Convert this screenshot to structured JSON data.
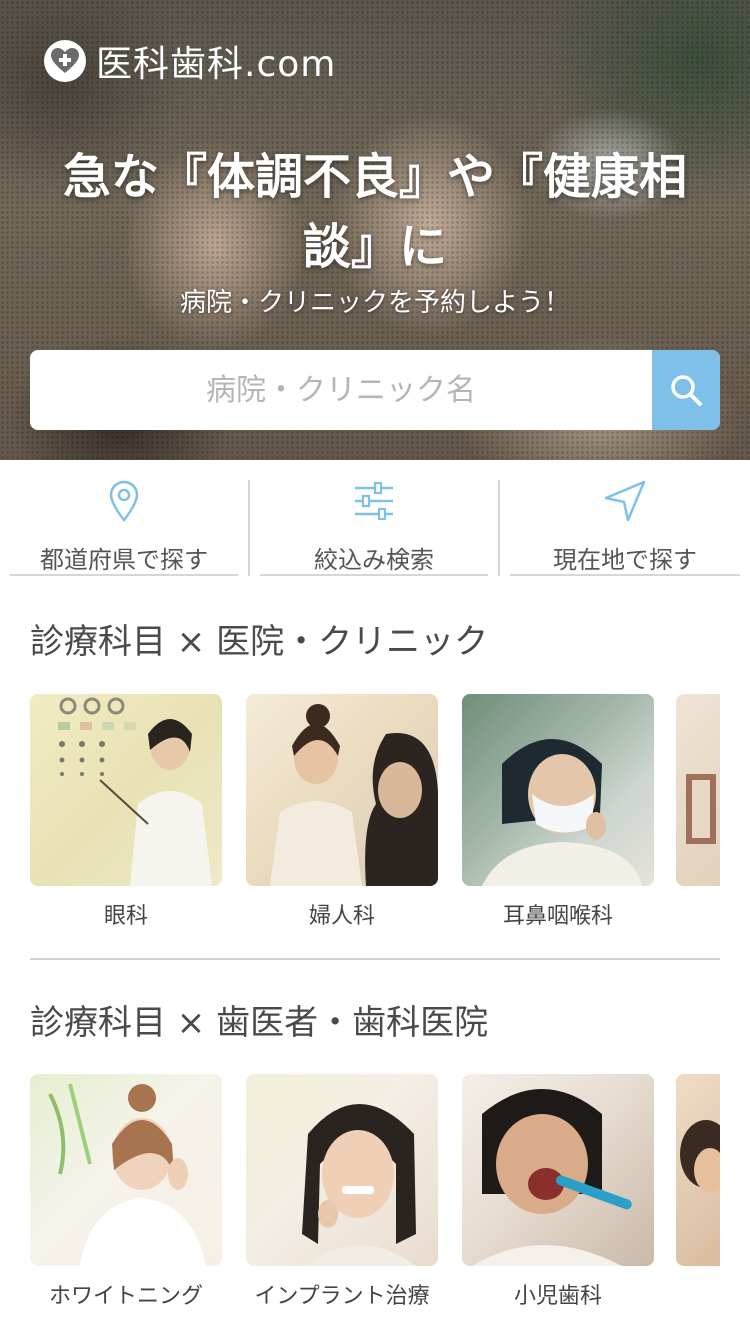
{
  "header": {
    "logo_text": "医科歯科.com",
    "headline": "急な『体調不良』や『健康相談』に",
    "subheadline": "病院・クリニックを予約しよう！"
  },
  "search": {
    "placeholder": "病院・クリニック名",
    "icon": "search-icon"
  },
  "quick_actions": [
    {
      "label": "都道府県で探す",
      "icon": "map-pin-icon"
    },
    {
      "label": "絞込み検索",
      "icon": "sliders-icon"
    },
    {
      "label": "現在地で探す",
      "icon": "navigation-arrow-icon"
    }
  ],
  "sections": [
    {
      "title": "診療科目 × 医院・クリニック",
      "cards": [
        {
          "label": "眼科"
        },
        {
          "label": "婦人科"
        },
        {
          "label": "耳鼻咽喉科"
        }
      ]
    },
    {
      "title": "診療科目 × 歯医者・歯科医院",
      "cards": [
        {
          "label": "ホワイトニング"
        },
        {
          "label": "インプラント治療"
        },
        {
          "label": "小児歯科"
        }
      ]
    }
  ],
  "colors": {
    "accent": "#7fc0e8",
    "text": "#444444",
    "divider": "#d6d6d6"
  }
}
